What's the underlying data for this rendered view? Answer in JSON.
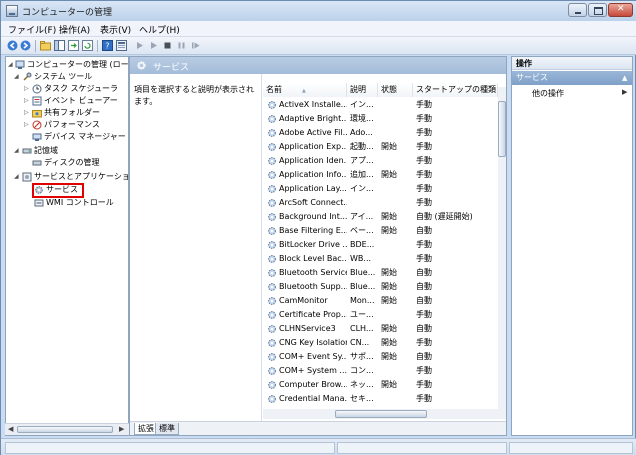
{
  "window": {
    "title": "コンピューターの管理"
  },
  "menu": [
    "ファイル(F)",
    "操作(A)",
    "表示(V)",
    "ヘルプ(H)"
  ],
  "toolbar": {
    "icons": [
      "back-arrow-icon",
      "forward-arrow-icon",
      "up-folder-icon",
      "console-tree-icon",
      "export-list-icon",
      "refresh-icon",
      "help-icon",
      "properties-icon",
      "play-icon",
      "play-alt-icon",
      "stop-icon",
      "pause-icon",
      "restart-icon"
    ]
  },
  "tree": {
    "root": "コンピューターの管理 (ローカル)",
    "system_tools": "システム ツール",
    "task_scheduler": "タスク スケジューラ",
    "event_viewer": "イベント ビューアー",
    "shared_folders": "共有フォルダー",
    "performance": "パフォーマンス",
    "device_manager": "デバイス マネージャー",
    "storage": "記憶域",
    "disk_management": "ディスクの管理",
    "services_apps": "サービスとアプリケーション",
    "services": "サービス",
    "wmi": "WMI コントロール"
  },
  "center": {
    "header": "サービス",
    "description": "項目を選択すると説明が表示されます。",
    "columns": [
      "名前",
      "説明",
      "状態",
      "スタートアップの種類"
    ],
    "rows": [
      {
        "name": "ActiveX Installe...",
        "desc": "イン...",
        "status": "",
        "startup": "手動"
      },
      {
        "name": "Adaptive Bright...",
        "desc": "環境...",
        "status": "",
        "startup": "手動"
      },
      {
        "name": "Adobe Active Fil...",
        "desc": "Ado...",
        "status": "",
        "startup": "手動"
      },
      {
        "name": "Application Exp...",
        "desc": "起動...",
        "status": "開始",
        "startup": "手動"
      },
      {
        "name": "Application Iden...",
        "desc": "アプ...",
        "status": "",
        "startup": "手動"
      },
      {
        "name": "Application Info...",
        "desc": "追加...",
        "status": "開始",
        "startup": "手動"
      },
      {
        "name": "Application Lay...",
        "desc": "イン...",
        "status": "",
        "startup": "手動"
      },
      {
        "name": "ArcSoft Connect...",
        "desc": "",
        "status": "",
        "startup": "手動"
      },
      {
        "name": "Background Int...",
        "desc": "アイ...",
        "status": "開始",
        "startup": "自動 (遅延開始)"
      },
      {
        "name": "Base Filtering E...",
        "desc": "ベー...",
        "status": "開始",
        "startup": "自動"
      },
      {
        "name": "BitLocker Drive ...",
        "desc": "BDE...",
        "status": "",
        "startup": "手動"
      },
      {
        "name": "Block Level Bac...",
        "desc": "WB...",
        "status": "",
        "startup": "手動"
      },
      {
        "name": "Bluetooth Service",
        "desc": "Blue...",
        "status": "開始",
        "startup": "自動"
      },
      {
        "name": "Bluetooth Supp...",
        "desc": "Blue...",
        "status": "開始",
        "startup": "自動"
      },
      {
        "name": "CamMonitor",
        "desc": "Mon...",
        "status": "開始",
        "startup": "自動"
      },
      {
        "name": "Certificate Prop...",
        "desc": "ユー...",
        "status": "",
        "startup": "手動"
      },
      {
        "name": "CLHNService3",
        "desc": "CLH...",
        "status": "開始",
        "startup": "自動"
      },
      {
        "name": "CNG Key Isolation",
        "desc": "CN...",
        "status": "開始",
        "startup": "手動"
      },
      {
        "name": "COM+ Event Sy...",
        "desc": "サポ...",
        "status": "開始",
        "startup": "自動"
      },
      {
        "name": "COM+ System ...",
        "desc": "コン...",
        "status": "",
        "startup": "手動"
      },
      {
        "name": "Computer Brow...",
        "desc": "ネッ...",
        "status": "開始",
        "startup": "手動"
      },
      {
        "name": "Credential Mana...",
        "desc": "セキ...",
        "status": "",
        "startup": "手動"
      }
    ]
  },
  "tabs": [
    "拡張",
    "標準"
  ],
  "right": {
    "header": "操作",
    "section": "サービス",
    "action": "他の操作"
  }
}
